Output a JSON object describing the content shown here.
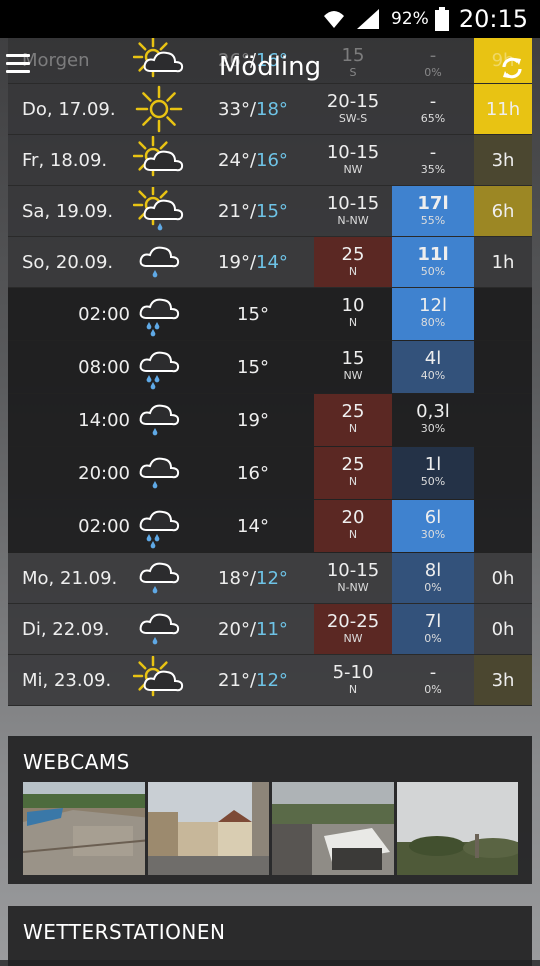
{
  "status_bar": {
    "battery": "92%",
    "time": "20:15"
  },
  "app": {
    "title": "Mödling"
  },
  "colors": {
    "sun_strong": "#e8c313",
    "sun_medium": "#9c8724",
    "sun_weak": "#4b4730",
    "rain_strong": "#3f82cf",
    "rain_medium": "#33527b",
    "rain_weak": "#243247",
    "wind_strong": "#5b2823",
    "temp_min": "#6ec3e6"
  },
  "forecast": [
    {
      "kind": "morgen",
      "date": "Morgen",
      "icon": "sun-cloud-icon",
      "tmax": "26°",
      "tmin": "16°",
      "wind": "15",
      "dir": "S",
      "prec": "-",
      "pct": "0%",
      "sun": "9h",
      "sun_level": "strong",
      "prec_level": "none",
      "wind_level": "none"
    },
    {
      "kind": "day",
      "date": "Do, 17.09.",
      "icon": "sun-icon",
      "tmax": "33°",
      "tmin": "18°",
      "wind": "20-15",
      "dir": "SW-S",
      "prec": "-",
      "pct": "65%",
      "sun": "11h",
      "sun_level": "strong",
      "prec_level": "none",
      "wind_level": "none"
    },
    {
      "kind": "day",
      "date": "Fr, 18.09.",
      "icon": "sun-cloud-icon",
      "tmax": "24°",
      "tmin": "16°",
      "wind": "10-15",
      "dir": "NW",
      "prec": "-",
      "pct": "35%",
      "sun": "3h",
      "sun_level": "weak",
      "prec_level": "none",
      "wind_level": "none"
    },
    {
      "kind": "day",
      "date": "Sa, 19.09.",
      "icon": "sun-cloud-rain-icon",
      "tmax": "21°",
      "tmin": "15°",
      "wind": "10-15",
      "dir": "N-NW",
      "prec": "17l",
      "pct": "55%",
      "sun": "6h",
      "sun_level": "medium",
      "prec_level": "strong",
      "prec_bold": true,
      "wind_level": "none"
    },
    {
      "kind": "day",
      "date": "So, 20.09.",
      "icon": "cloud-rain-icon",
      "tmax": "19°",
      "tmin": "14°",
      "wind": "25",
      "dir": "N",
      "prec": "11l",
      "pct": "50%",
      "sun": "1h",
      "sun_level": "none",
      "prec_level": "strong",
      "prec_bold": true,
      "wind_level": "strong"
    },
    {
      "kind": "hour",
      "date": "02:00",
      "icon": "cloud-heavy-rain-icon",
      "temp": "15°",
      "wind": "10",
      "dir": "N",
      "prec": "12l",
      "pct": "80%",
      "prec_level": "strong",
      "wind_level": "none"
    },
    {
      "kind": "hour",
      "date": "08:00",
      "icon": "cloud-heavy-rain-icon",
      "temp": "15°",
      "wind": "15",
      "dir": "NW",
      "prec": "4l",
      "pct": "40%",
      "prec_level": "medium",
      "wind_level": "none"
    },
    {
      "kind": "hour",
      "date": "14:00",
      "icon": "cloud-rain-icon",
      "temp": "19°",
      "wind": "25",
      "dir": "N",
      "prec": "0,3l",
      "pct": "30%",
      "prec_level": "none",
      "wind_level": "strong"
    },
    {
      "kind": "hour",
      "date": "20:00",
      "icon": "cloud-rain-icon",
      "temp": "16°",
      "wind": "25",
      "dir": "N",
      "prec": "1l",
      "pct": "50%",
      "prec_level": "weak",
      "wind_level": "strong"
    },
    {
      "kind": "hour",
      "date": "02:00",
      "icon": "cloud-heavy-rain-icon",
      "temp": "14°",
      "wind": "20",
      "dir": "N",
      "prec": "6l",
      "pct": "30%",
      "prec_level": "strong",
      "wind_level": "strong"
    },
    {
      "kind": "day",
      "date": "Mo, 21.09.",
      "icon": "cloud-rain-icon",
      "tmax": "18°",
      "tmin": "12°",
      "wind": "10-15",
      "dir": "N-NW",
      "prec": "8l",
      "pct": "0%",
      "sun": "0h",
      "sun_level": "none",
      "prec_level": "medium",
      "wind_level": "none"
    },
    {
      "kind": "day",
      "date": "Di, 22.09.",
      "icon": "cloud-rain-icon",
      "tmax": "20°",
      "tmin": "11°",
      "wind": "20-25",
      "dir": "NW",
      "prec": "7l",
      "pct": "0%",
      "sun": "0h",
      "sun_level": "none",
      "prec_level": "medium",
      "wind_level": "strong"
    },
    {
      "kind": "day",
      "date": "Mi, 23.09.",
      "icon": "sun-cloud-icon",
      "tmax": "21°",
      "tmin": "12°",
      "wind": "5-10",
      "dir": "N",
      "prec": "-",
      "pct": "0%",
      "sun": "3h",
      "sun_level": "weak",
      "prec_level": "none",
      "wind_level": "none"
    }
  ],
  "webcams": {
    "title": "WEBCAMS",
    "items": [
      "webcam-pool",
      "webcam-square",
      "webcam-rooftop",
      "webcam-trees"
    ]
  },
  "stations": {
    "title": "WETTERSTATIONEN"
  }
}
